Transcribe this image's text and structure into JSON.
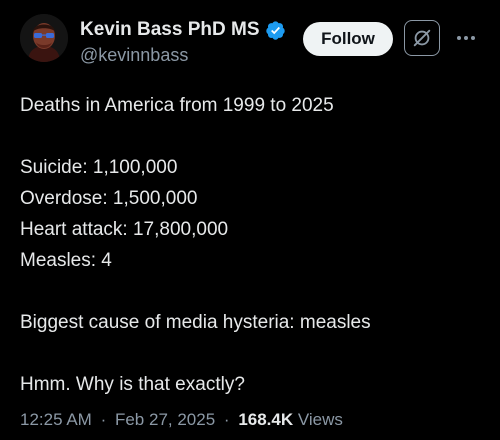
{
  "author": {
    "display_name": "Kevin Bass PhD MS",
    "handle": "@kevinnbass",
    "verified": true,
    "verified_color": "#1d9bf0"
  },
  "actions": {
    "follow_label": "Follow",
    "grok_icon": "grok-icon",
    "more_icon": "more-horizontal-icon"
  },
  "tweet": {
    "lines": {
      "intro": "Deaths in America from 1999 to 2025",
      "suicide": "Suicide: 1,100,000",
      "overdose": "Overdose: 1,500,000",
      "heart_attack": "Heart attack: 17,800,000",
      "measles": "Measles: 4",
      "hysteria": "Biggest cause of media hysteria: measles",
      "question": "Hmm. Why is that exactly?"
    }
  },
  "meta": {
    "time": "12:25 AM",
    "date": "Feb 27, 2025",
    "separator": "·",
    "views_count": "168.4K",
    "views_label": "Views"
  },
  "colors": {
    "background": "#000000",
    "text_primary": "#e7e9ea",
    "text_secondary": "#8b98a5",
    "follow_bg": "#eff3f4"
  }
}
